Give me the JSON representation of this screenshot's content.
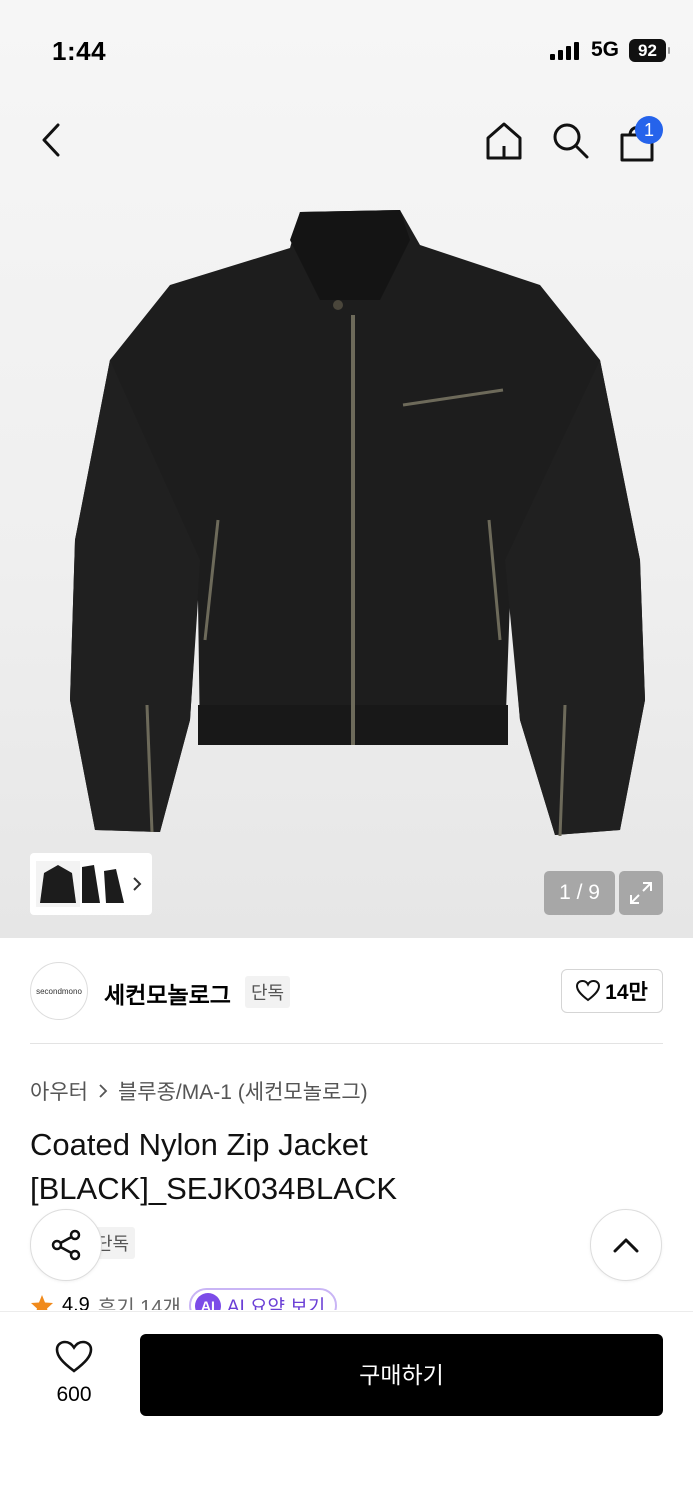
{
  "status_bar": {
    "time": "1:44",
    "network": "5G",
    "battery": "92"
  },
  "header": {
    "cart_badge": "1"
  },
  "gallery": {
    "counter": "1 / 9"
  },
  "brand": {
    "logo_text": "secondmono",
    "name": "세컨모놀로그",
    "tag": "단독",
    "likes": "14만"
  },
  "breadcrumb": {
    "category": "아우터",
    "subcategory": "블루종/MA-1 (세컨모놀로그)"
  },
  "product": {
    "title": "Coated Nylon Zip Jacket [BLACK]_SEJK034BLACK",
    "tag": "단독",
    "rating": "4.9",
    "reviews": "후기 14개",
    "ai_label": "AI",
    "ai_summary": "AI 요약 보기"
  },
  "bottom_bar": {
    "wish_count": "600",
    "buy_label": "구매하기"
  }
}
